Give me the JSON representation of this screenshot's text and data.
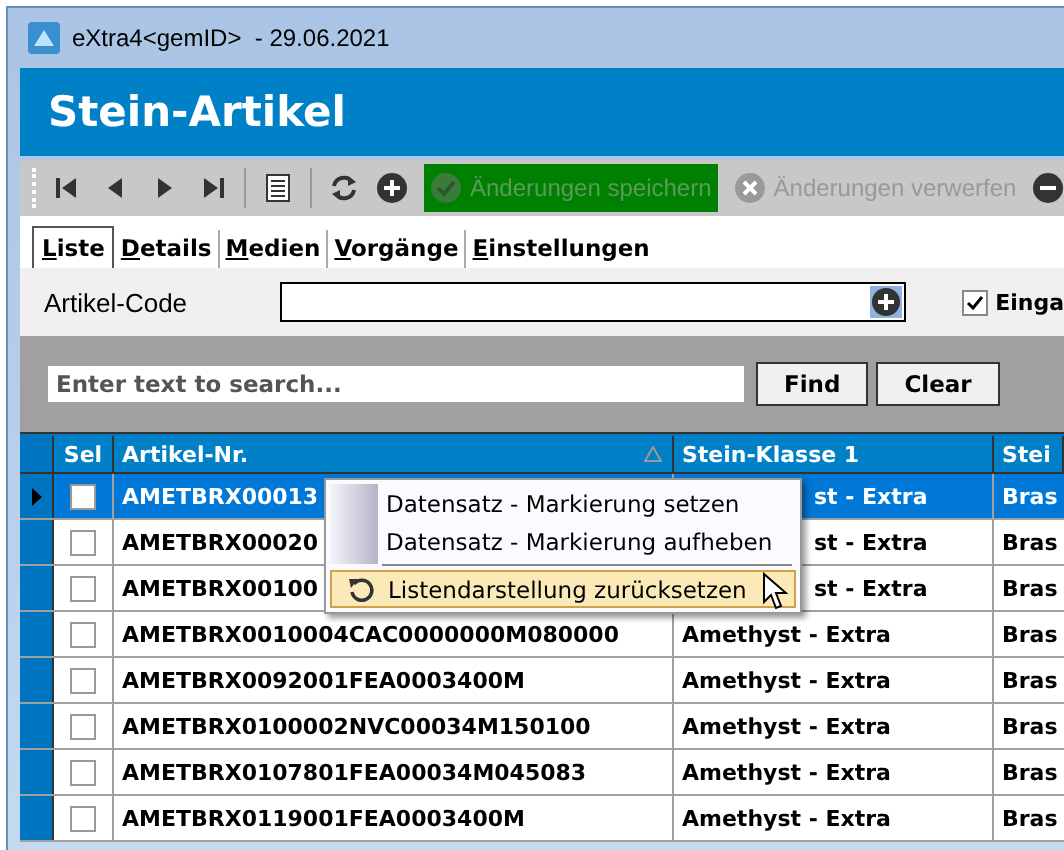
{
  "window": {
    "title": "eXtra4<gemID>  - 29.06.2021"
  },
  "header": {
    "title": "Stein-Artikel"
  },
  "toolbar": [
    {
      "kind": "first"
    },
    {
      "kind": "prev"
    },
    {
      "kind": "next"
    },
    {
      "kind": "last"
    },
    {
      "kind": "sep"
    },
    {
      "kind": "list"
    },
    {
      "kind": "sep"
    },
    {
      "kind": "refresh"
    },
    {
      "kind": "add"
    },
    {
      "kind": "save",
      "label": "Änderungen speichern",
      "disabled": true
    },
    {
      "kind": "discard",
      "label": "Änderungen verwerfen",
      "disabled": true
    },
    {
      "kind": "remove"
    }
  ],
  "tabs": [
    {
      "label": "Liste",
      "selected": true
    },
    {
      "label": "Details",
      "selected": false
    },
    {
      "label": "Medien",
      "selected": false
    },
    {
      "label": "Vorgänge",
      "selected": false
    },
    {
      "label": "Einstellungen",
      "selected": false
    }
  ],
  "filter": {
    "label": "Artikel-Code",
    "checkbox": {
      "label": "Einga",
      "checked": true
    }
  },
  "search": {
    "placeholder": "Enter text to search...",
    "buttons": [
      "Find",
      "Clear"
    ]
  },
  "table": {
    "columns": [
      "Sel",
      "Artikel-Nr.",
      "Stein-Klasse 1",
      "Stei"
    ],
    "rows": [
      {
        "current": true,
        "selected": true,
        "checked": false,
        "cells": [
          "",
          "AMETBRX00013",
          "st - Extra",
          "Bras"
        ]
      },
      {
        "current": false,
        "selected": false,
        "checked": false,
        "cells": [
          "",
          "AMETBRX00020",
          "st - Extra",
          "Bras"
        ]
      },
      {
        "current": false,
        "selected": false,
        "checked": false,
        "cells": [
          "",
          "AMETBRX00100",
          "st - Extra",
          "Bras"
        ]
      },
      {
        "current": false,
        "selected": false,
        "checked": false,
        "cells": [
          "",
          "AMETBRX0010004CAC0000000M080000",
          "Amethyst - Extra",
          "Bras"
        ]
      },
      {
        "current": false,
        "selected": false,
        "checked": false,
        "cells": [
          "",
          "AMETBRX0092001FEA0003400M",
          "Amethyst - Extra",
          "Bras"
        ]
      },
      {
        "current": false,
        "selected": false,
        "checked": false,
        "cells": [
          "",
          "AMETBRX0100002NVC00034M150100",
          "Amethyst - Extra",
          "Bras"
        ]
      },
      {
        "current": false,
        "selected": false,
        "checked": false,
        "cells": [
          "",
          "AMETBRX0107801FEA00034M045083",
          "Amethyst - Extra",
          "Bras"
        ]
      },
      {
        "current": false,
        "selected": false,
        "checked": false,
        "cells": [
          "",
          "AMETBRX0119001FEA0003400M",
          "Amethyst - Extra",
          "Bras"
        ]
      }
    ]
  },
  "context_menu": [
    {
      "kind": "item",
      "label": "Datensatz - Markierung setzen",
      "selected": false
    },
    {
      "kind": "item",
      "label": "Datensatz - Markierung aufheben",
      "selected": false
    },
    {
      "kind": "separator"
    },
    {
      "kind": "reset",
      "label": "Listendarstellung zurücksetzen",
      "selected": true
    }
  ]
}
